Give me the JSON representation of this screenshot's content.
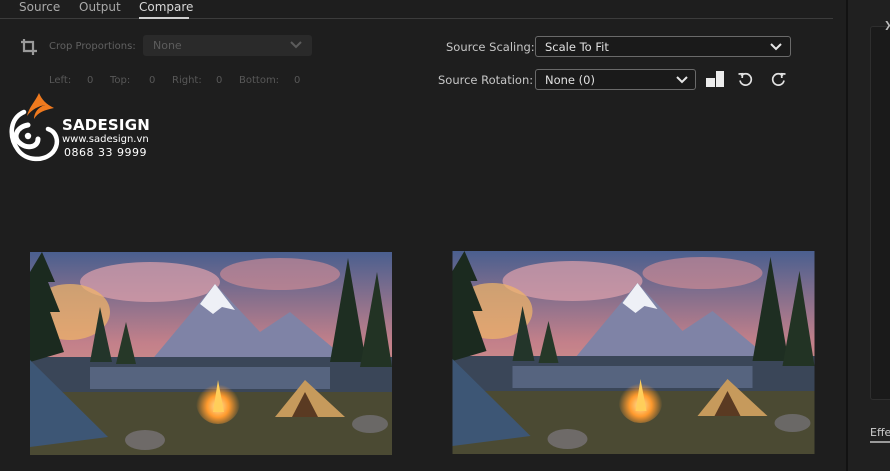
{
  "tabs": [
    {
      "label": "Source"
    },
    {
      "label": "Output"
    },
    {
      "label": "Compare"
    }
  ],
  "active_tab": "Compare",
  "crop": {
    "label": "Crop Proportions:",
    "value": "None",
    "left_label": "Left:",
    "left_value": "0",
    "top_label": "Top:",
    "top_value": "0",
    "right_label": "Right:",
    "right_value": "0",
    "bottom_label": "Bottom:",
    "bottom_value": "0"
  },
  "scaling": {
    "label": "Source Scaling:",
    "value": "Scale To Fit"
  },
  "rotation": {
    "label": "Source Rotation:",
    "value": "None (0)"
  },
  "watermark": {
    "brand": "SADESIGN",
    "website": "www.sadesign.vn",
    "phone": "0868 33 9999"
  },
  "side_panel": {
    "effects_label": "Effe"
  },
  "icons": {
    "crop": "crop-icon",
    "flip": "flip-icon",
    "rotate_ccw": "rotate-ccw-icon",
    "rotate_cw": "rotate-cw-icon",
    "chevron": "chevron-down-icon"
  }
}
